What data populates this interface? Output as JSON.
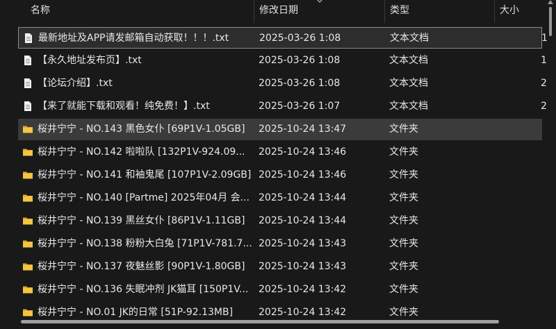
{
  "columns": {
    "name": "名称",
    "date": "修改日期",
    "type": "类型",
    "size": "大小"
  },
  "files": [
    {
      "name": "最新地址及APP请发邮箱自动获取！！！.txt",
      "date": "2025-03-26 1:08",
      "type": "文本文档",
      "size": "1",
      "kind": "text-file-icon",
      "state": "focused"
    },
    {
      "name": "【永久地址发布页】.txt",
      "date": "2025-03-26 1:08",
      "type": "文本文档",
      "size": "1",
      "kind": "text-file-icon",
      "state": ""
    },
    {
      "name": "【论坛介绍】.txt",
      "date": "2025-03-26 1:08",
      "type": "文本文档",
      "size": "2",
      "kind": "text-file-icon",
      "state": ""
    },
    {
      "name": "【来了就能下载和观看！纯免费！】.txt",
      "date": "2025-03-26 1:07",
      "type": "文本文档",
      "size": "2",
      "kind": "text-file-icon",
      "state": ""
    },
    {
      "name": "桜井宁宁 - NO.143 黑色女仆 [69P1V-1.05GB]",
      "date": "2025-10-24 13:47",
      "type": "文件夹",
      "size": "",
      "kind": "folder-icon",
      "state": "selected"
    },
    {
      "name": "桜井宁宁 - NO.142 啦啦队 [132P1V-924.09...",
      "date": "2025-10-24 13:46",
      "type": "文件夹",
      "size": "",
      "kind": "folder-icon",
      "state": ""
    },
    {
      "name": "桜井宁宁 - NO.141 和袖鬼尾 [107P1V-2.09GB]",
      "date": "2025-10-24 13:46",
      "type": "文件夹",
      "size": "",
      "kind": "folder-icon",
      "state": ""
    },
    {
      "name": "桜井宁宁 - NO.140 [Partme] 2025年04月 会...",
      "date": "2025-10-24 13:44",
      "type": "文件夹",
      "size": "",
      "kind": "folder-icon",
      "state": ""
    },
    {
      "name": "桜井宁宁 - NO.139 黑丝女仆 [86P1V-1.11GB]",
      "date": "2025-10-24 13:44",
      "type": "文件夹",
      "size": "",
      "kind": "folder-icon",
      "state": ""
    },
    {
      "name": "桜井宁宁 - NO.138 粉粉大白兔 [71P1V-781.7...",
      "date": "2025-10-24 13:43",
      "type": "文件夹",
      "size": "",
      "kind": "folder-icon",
      "state": ""
    },
    {
      "name": "桜井宁宁 - NO.137 夜魅丝影 [90P1V-1.80GB]",
      "date": "2025-10-24 13:43",
      "type": "文件夹",
      "size": "",
      "kind": "folder-icon",
      "state": ""
    },
    {
      "name": "桜井宁宁 - NO.136 失眠冲剂 JK猫耳 [150P1V...",
      "date": "2025-10-24 13:42",
      "type": "文件夹",
      "size": "",
      "kind": "folder-icon",
      "state": ""
    },
    {
      "name": "桜井宁宁 - NO.01 JK的日常 [51P-92.13MB]",
      "date": "2025-10-24 13:42",
      "type": "文件夹",
      "size": "",
      "kind": "folder-icon",
      "state": ""
    }
  ],
  "colors": {
    "background": "#191919",
    "folder": "#f4c542",
    "text": "#e8e8e8"
  }
}
